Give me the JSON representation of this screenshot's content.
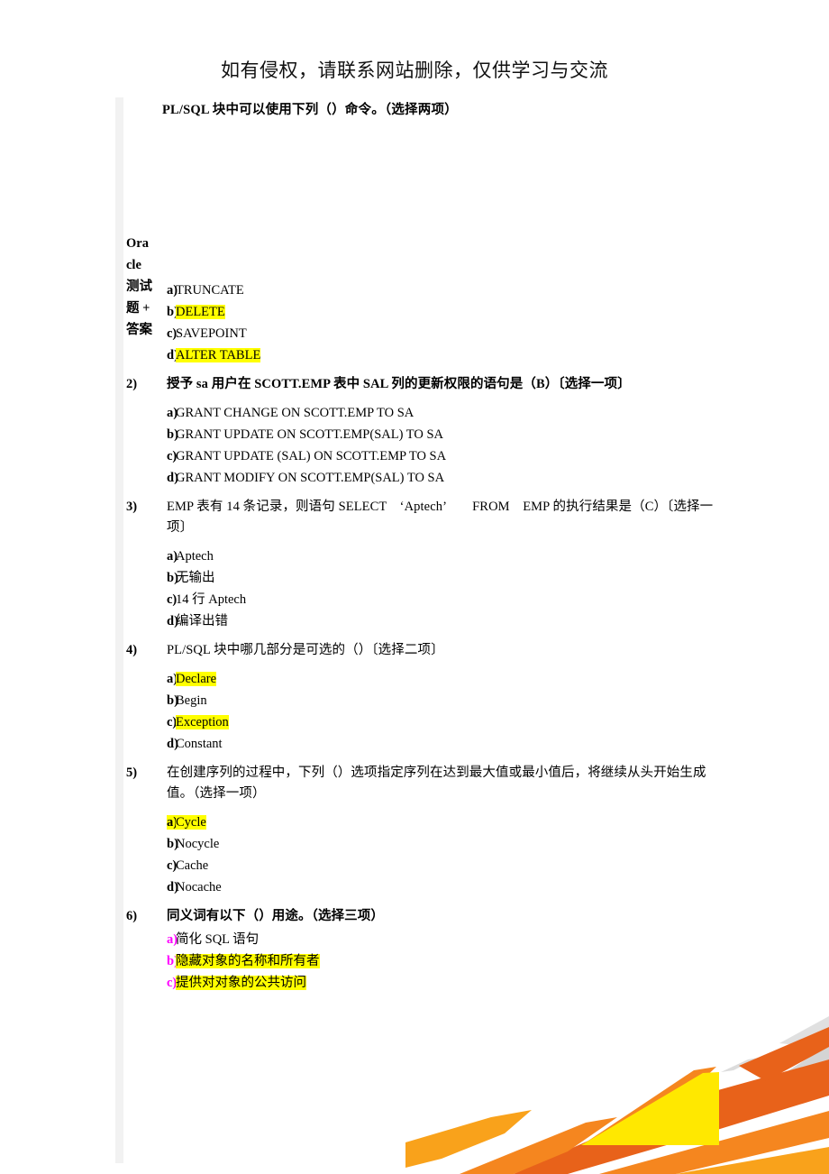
{
  "header": {
    "note": "如有侵权，请联系网站删除，仅供学习与交流"
  },
  "sidebar": {
    "title_lines": [
      "Ora",
      "cle",
      "测试",
      "题 +",
      "答案"
    ]
  },
  "lead": {
    "text": "PL/SQL 块中可以使用下列（）命令。（选择两项）"
  },
  "questions": [
    {
      "number": "",
      "text": "",
      "options": [
        {
          "letter": "a)",
          "text": "TRUNCATE",
          "highlight": false,
          "letter_highlight": false,
          "letter_color": ""
        },
        {
          "letter": "b)",
          "text": "DELETE",
          "highlight": true,
          "letter_highlight": false,
          "letter_color": ""
        },
        {
          "letter": "c)",
          "text": "SAVEPOINT",
          "highlight": false,
          "letter_highlight": false,
          "letter_color": ""
        },
        {
          "letter": "d)",
          "text": "ALTER TABLE",
          "highlight": true,
          "letter_highlight": false,
          "letter_color": ""
        }
      ]
    },
    {
      "number": "2)",
      "text": "授予 sa 用户在 SCOTT.EMP 表中 SAL 列的更新权限的语句是（B）〔选择一项〕",
      "bold": true,
      "options": [
        {
          "letter": "a)",
          "text": "GRANT   CHANGE   ON   SCOTT.EMP TO SA",
          "highlight": false,
          "letter_highlight": false,
          "letter_color": ""
        },
        {
          "letter": "b)",
          "text": "GRANT   UPDATE   ON   SCOTT.EMP(SAL)   TO   SA",
          "highlight": false,
          "letter_highlight": false,
          "letter_color": ""
        },
        {
          "letter": "c)",
          "text": "GRANT   UPDATE (SAL)   ON   SCOTT.EMP   TO   SA",
          "highlight": false,
          "letter_highlight": false,
          "letter_color": ""
        },
        {
          "letter": "d)",
          "text": "GRANT   MODIFY   ON   SCOTT.EMP(SAL)   TO   SA",
          "highlight": false,
          "letter_highlight": false,
          "letter_color": ""
        }
      ]
    },
    {
      "number": "3)",
      "text": "EMP 表有 14 条记录，则语句 SELECT　‘Aptech’　　FROM　EMP 的执行结果是（C）〔选择一项〕",
      "bold": false,
      "options": [
        {
          "letter": "a)",
          "text": "Aptech",
          "highlight": false,
          "letter_highlight": false,
          "letter_color": ""
        },
        {
          "letter": "b)",
          "text": "无输出",
          "highlight": false,
          "letter_highlight": false,
          "letter_color": ""
        },
        {
          "letter": "c)",
          "text": "14 行 Aptech",
          "highlight": false,
          "letter_highlight": false,
          "letter_color": ""
        },
        {
          "letter": "d)",
          "text": "编译出错",
          "highlight": false,
          "letter_highlight": false,
          "letter_color": ""
        }
      ]
    },
    {
      "number": "4)",
      "text": "PL/SQL 块中哪几部分是可选的（）〔选择二项〕",
      "bold": false,
      "options": [
        {
          "letter": "a)",
          "text": "Declare",
          "highlight": true,
          "letter_highlight": false,
          "letter_color": ""
        },
        {
          "letter": "b)",
          "text": "Begin",
          "highlight": false,
          "letter_highlight": false,
          "letter_color": ""
        },
        {
          "letter": "c)",
          "text": "Exception",
          "highlight": true,
          "letter_highlight": false,
          "letter_color": ""
        },
        {
          "letter": "d)",
          "text": "Constant",
          "highlight": false,
          "letter_highlight": false,
          "letter_color": ""
        }
      ]
    },
    {
      "number": "5)",
      "text": "在创建序列的过程中，下列（）选项指定序列在达到最大值或最小值后，将继续从头开始生成值。（选择一项）",
      "bold": false,
      "options": [
        {
          "letter": "a)",
          "text": "Cycle",
          "highlight": true,
          "letter_highlight": true,
          "letter_color": ""
        },
        {
          "letter": "b)",
          "text": "Nocycle",
          "highlight": false,
          "letter_highlight": false,
          "letter_color": ""
        },
        {
          "letter": "c)",
          "text": "Cache",
          "highlight": false,
          "letter_highlight": false,
          "letter_color": ""
        },
        {
          "letter": "d)",
          "text": "Nocache",
          "highlight": false,
          "letter_highlight": false,
          "letter_color": ""
        }
      ]
    },
    {
      "number": "6)",
      "text": "同义词有以下（）用途。（选择三项）",
      "bold": true,
      "options": [
        {
          "letter": "a)",
          "text": "简化 SQL 语句",
          "highlight": false,
          "letter_highlight": false,
          "letter_color": "#ff00ff"
        },
        {
          "letter": "b)",
          "text": "隐藏对象的名称和所有者",
          "highlight": true,
          "letter_highlight": false,
          "letter_color": "#ff00ff"
        },
        {
          "letter": "c)",
          "text": "提供对对象的公共访问",
          "highlight": true,
          "letter_highlight": false,
          "letter_color": "#ff00ff"
        }
      ]
    }
  ],
  "colors": {
    "highlight": "#ffff00",
    "option_letter_accent": "#ff00ff",
    "gutter": "#f2f2f2",
    "decor_orange_dark": "#e8621a",
    "decor_orange": "#f5861f",
    "decor_orange_light": "#f9a21b",
    "decor_yellow": "#ffe800",
    "decor_gray": "#d3d3d3"
  }
}
